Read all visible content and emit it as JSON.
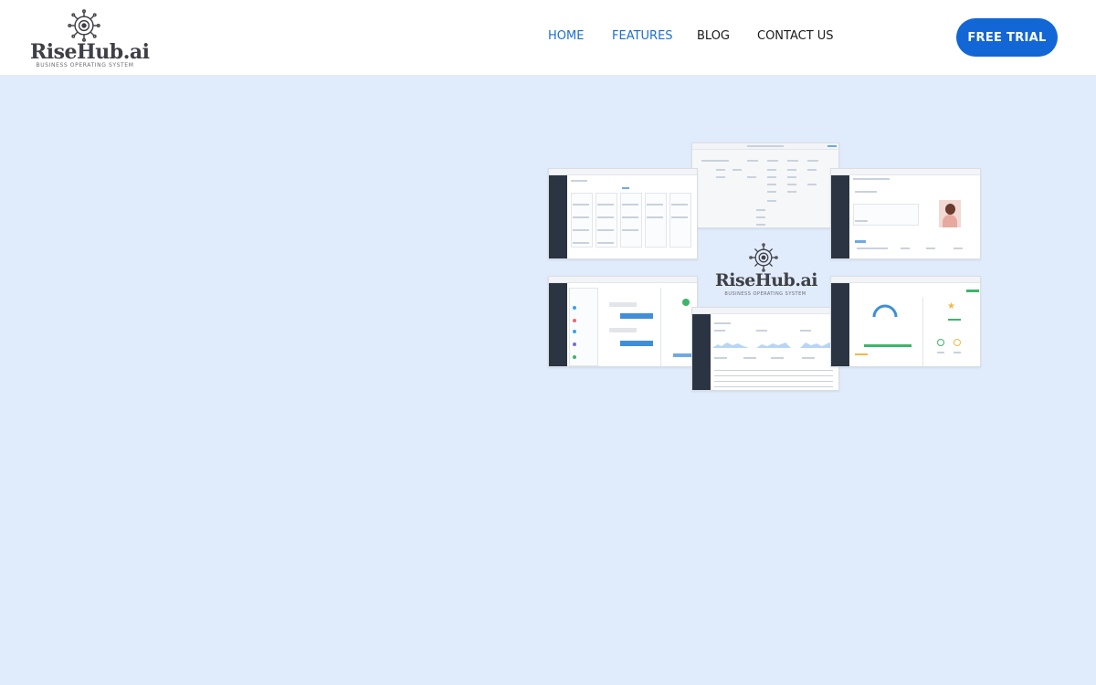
{
  "brand": {
    "name": "RiseHub.ai",
    "tagline": "BUSINESS OPERATING SYSTEM",
    "logo_icon": "circuit-gear-icon",
    "color": "#3f3f46"
  },
  "nav": {
    "items": [
      {
        "label": "HOME",
        "active": true
      },
      {
        "label": "FEATURES",
        "active": true
      },
      {
        "label": "BLOG",
        "active": false
      },
      {
        "label": "CONTACT US",
        "active": false
      }
    ],
    "active_color": "#1b6fd1"
  },
  "cta": {
    "label": "FREE TRIAL",
    "color": "#1266d6"
  },
  "hero": {
    "background": "#e0ecfb",
    "collage": {
      "brand_name": "RiseHub.ai",
      "brand_tagline": "BUSINESS OPERATING SYSTEM"
    }
  }
}
